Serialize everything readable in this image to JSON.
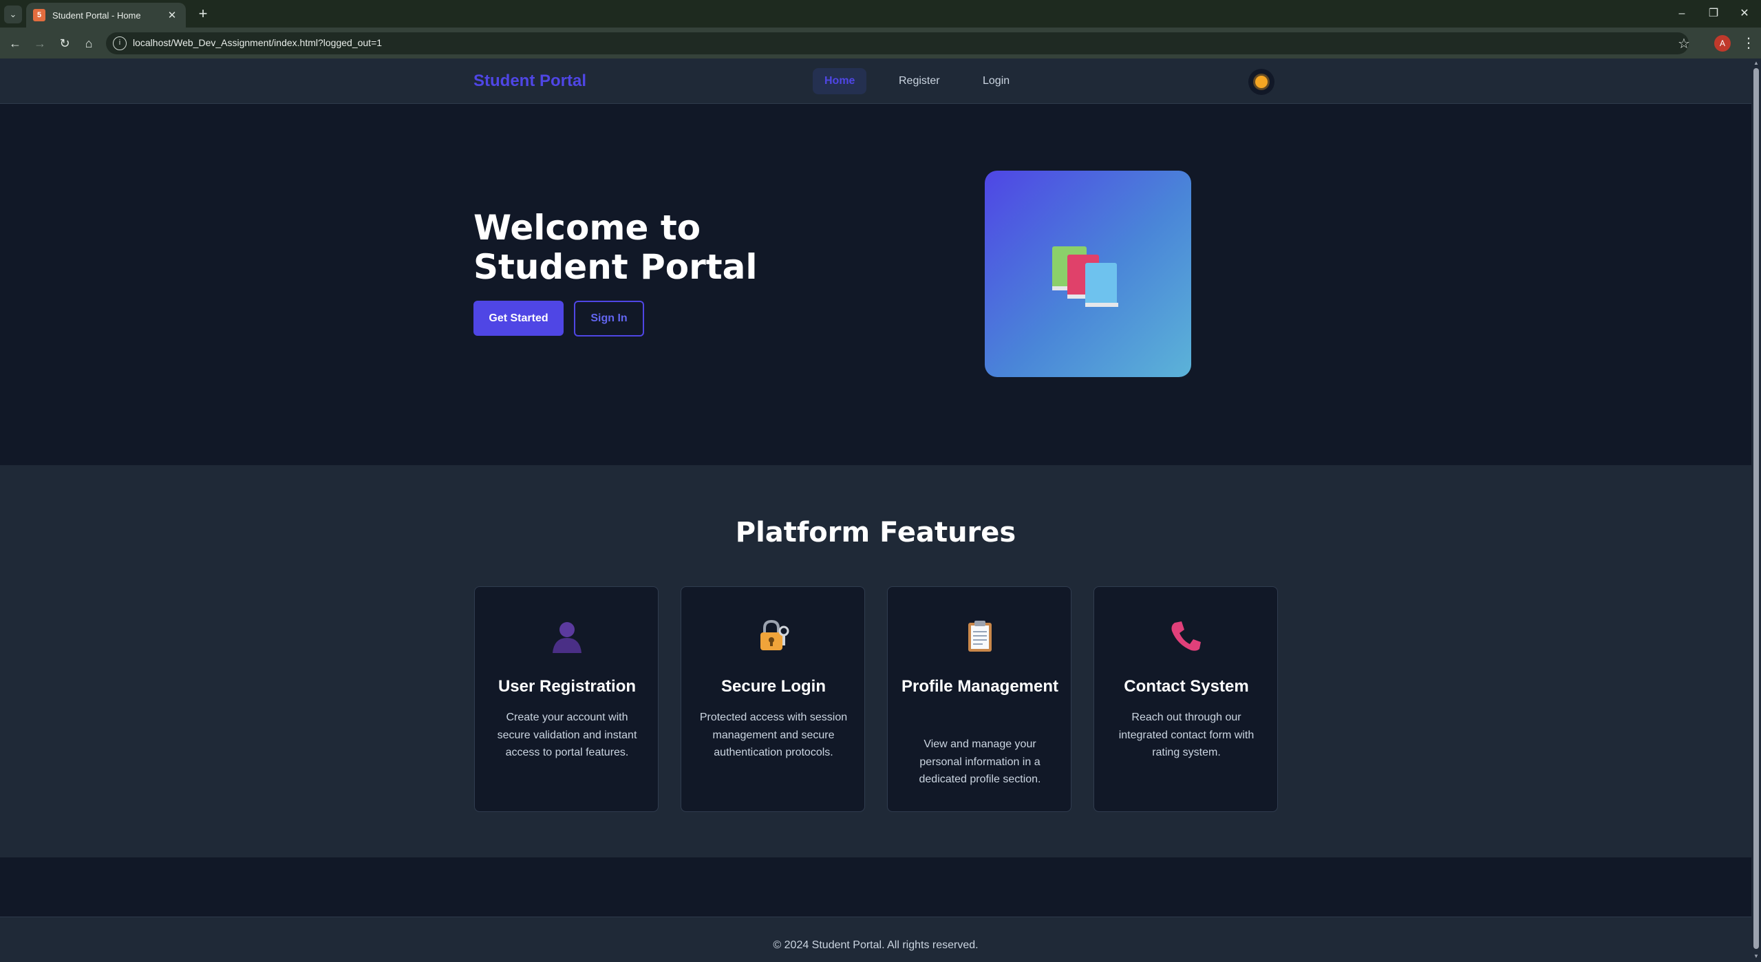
{
  "browser": {
    "tab_title": "Student Portal - Home",
    "url": "localhost/Web_Dev_Assignment/index.html?logged_out=1",
    "profile_initial": "A"
  },
  "nav": {
    "brand": "Student Portal",
    "links": [
      {
        "label": "Home",
        "active": true
      },
      {
        "label": "Register",
        "active": false
      },
      {
        "label": "Login",
        "active": false
      }
    ],
    "theme_icon": "sun-icon"
  },
  "hero": {
    "title": "Welcome to Student Portal",
    "primary_button": "Get Started",
    "secondary_button": "Sign In",
    "image_icon": "books-icon"
  },
  "features": {
    "title": "Platform Features",
    "cards": [
      {
        "icon": "user-silhouette-icon",
        "title": "User Registration",
        "description": "Create your account with secure validation and instant access to portal features."
      },
      {
        "icon": "lock-key-icon",
        "title": "Secure Login",
        "description": "Protected access with session management and secure authentication protocols."
      },
      {
        "icon": "clipboard-icon",
        "title": "Profile Management",
        "description": "View and manage your personal information in a dedicated profile section."
      },
      {
        "icon": "telephone-icon",
        "title": "Contact System",
        "description": "Reach out through our integrated contact form with rating system."
      }
    ]
  },
  "footer": {
    "text": "© 2024 Student Portal. All rights reserved."
  },
  "colors": {
    "accent": "#4f46e5",
    "background": "#111827",
    "surface": "#1f2937"
  }
}
